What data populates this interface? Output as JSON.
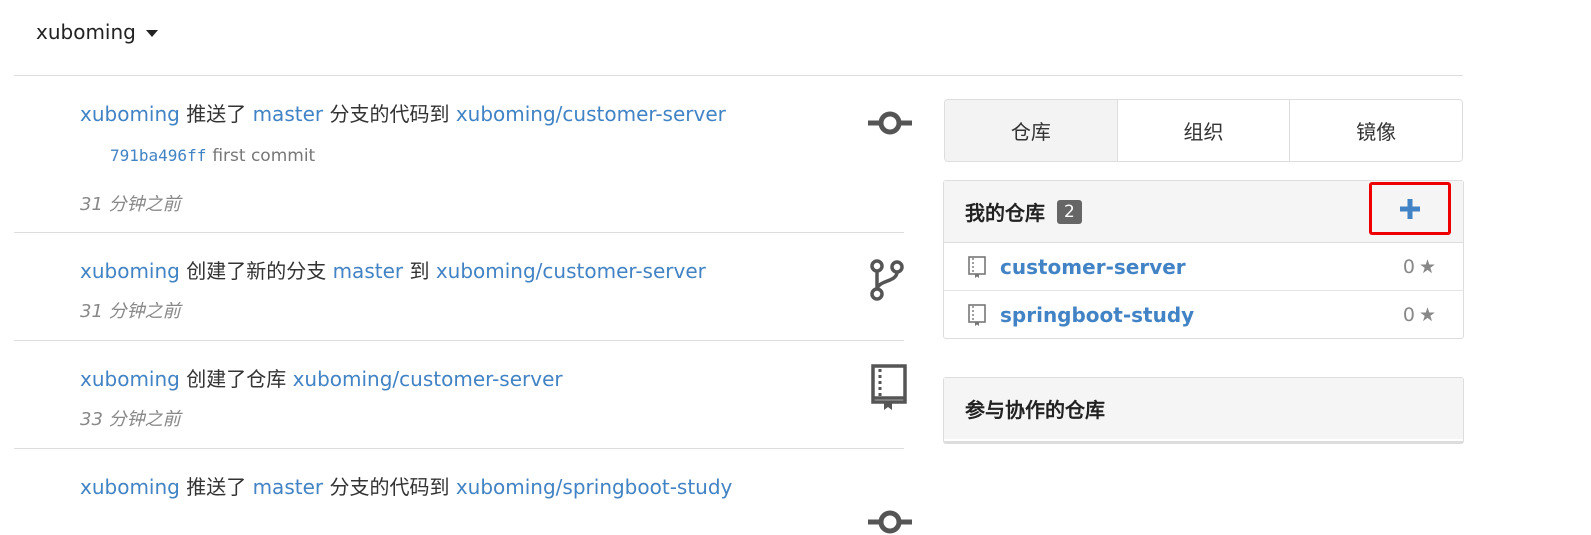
{
  "context": {
    "user": "xuboming"
  },
  "feed": [
    {
      "parts": [
        [
          "link",
          "xuboming"
        ],
        [
          "text",
          " 推送了 "
        ],
        [
          "link",
          "master"
        ],
        [
          "text",
          " 分支的代码到 "
        ],
        [
          "link",
          "xuboming/customer-server"
        ]
      ],
      "commit": {
        "sha": "791ba496ff",
        "message": "first commit"
      },
      "time": "31 分钟之前",
      "icon": "commit-icon"
    },
    {
      "parts": [
        [
          "link",
          "xuboming"
        ],
        [
          "text",
          " 创建了新的分支 "
        ],
        [
          "link",
          "master"
        ],
        [
          "text",
          " 到 "
        ],
        [
          "link",
          "xuboming/customer-server"
        ]
      ],
      "time": "31 分钟之前",
      "icon": "branch-icon"
    },
    {
      "parts": [
        [
          "link",
          "xuboming"
        ],
        [
          "text",
          " 创建了仓库 "
        ],
        [
          "link",
          "xuboming/customer-server"
        ]
      ],
      "time": "33 分钟之前",
      "icon": "book-icon"
    },
    {
      "parts": [
        [
          "link",
          "xuboming"
        ],
        [
          "text",
          " 推送了 "
        ],
        [
          "link",
          "master"
        ],
        [
          "text",
          " 分支的代码到 "
        ],
        [
          "link",
          "xuboming/springboot-study"
        ]
      ],
      "icon": "commit-icon"
    }
  ],
  "tabs": [
    "仓库",
    "组织",
    "镜像"
  ],
  "my_repos": {
    "title": "我的仓库",
    "count": "2",
    "items": [
      {
        "name": "customer-server",
        "stars": "0"
      },
      {
        "name": "springboot-study",
        "stars": "0"
      }
    ]
  },
  "collab": {
    "title": "参与协作的仓库"
  },
  "colors": {
    "link": "#4183c4",
    "highlight": "#e00000"
  }
}
